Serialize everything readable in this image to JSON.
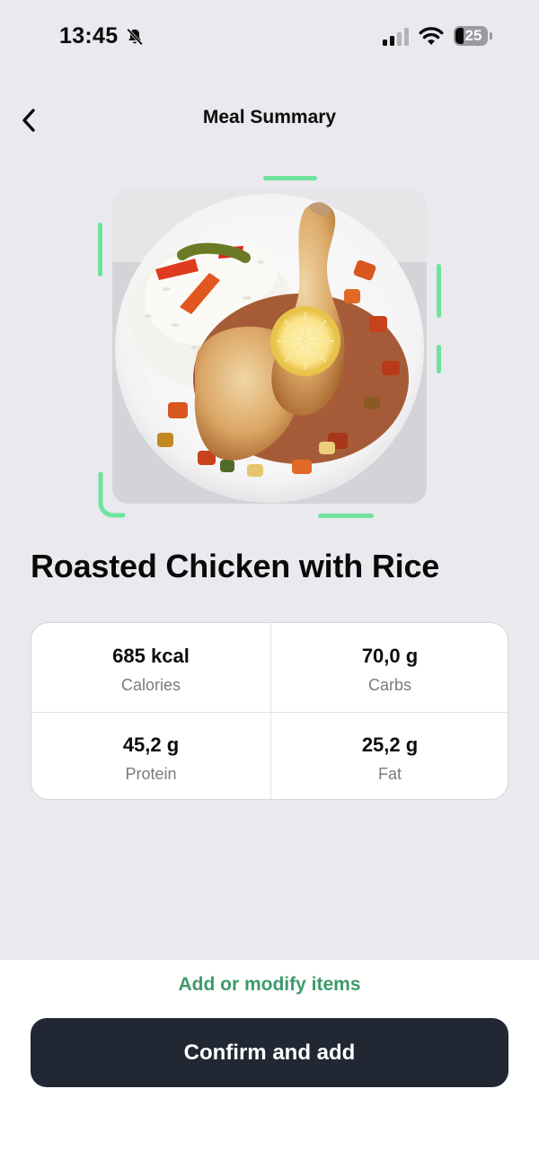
{
  "status_bar": {
    "time": "13:45",
    "battery_level": "25",
    "icons": [
      "bell-off-icon",
      "cellular-signal-icon",
      "wifi-icon",
      "battery-icon"
    ]
  },
  "nav": {
    "title": "Meal Summary",
    "back_icon": "chevron-left-icon"
  },
  "meal": {
    "name": "Roasted Chicken with Rice",
    "photo_description_icon": "meal-photo"
  },
  "nutrition": [
    {
      "value": "685 kcal",
      "label": "Calories"
    },
    {
      "value": "70,0 g",
      "label": "Carbs"
    },
    {
      "value": "45,2 g",
      "label": "Protein"
    },
    {
      "value": "25,2 g",
      "label": "Fat"
    }
  ],
  "actions": {
    "modify_label": "Add or modify items",
    "confirm_label": "Confirm and add"
  },
  "colors": {
    "accent_green": "#3e9a69",
    "scan_frame": "#6ee39b",
    "button_dark": "#212834",
    "background": "#e9e9ee"
  }
}
